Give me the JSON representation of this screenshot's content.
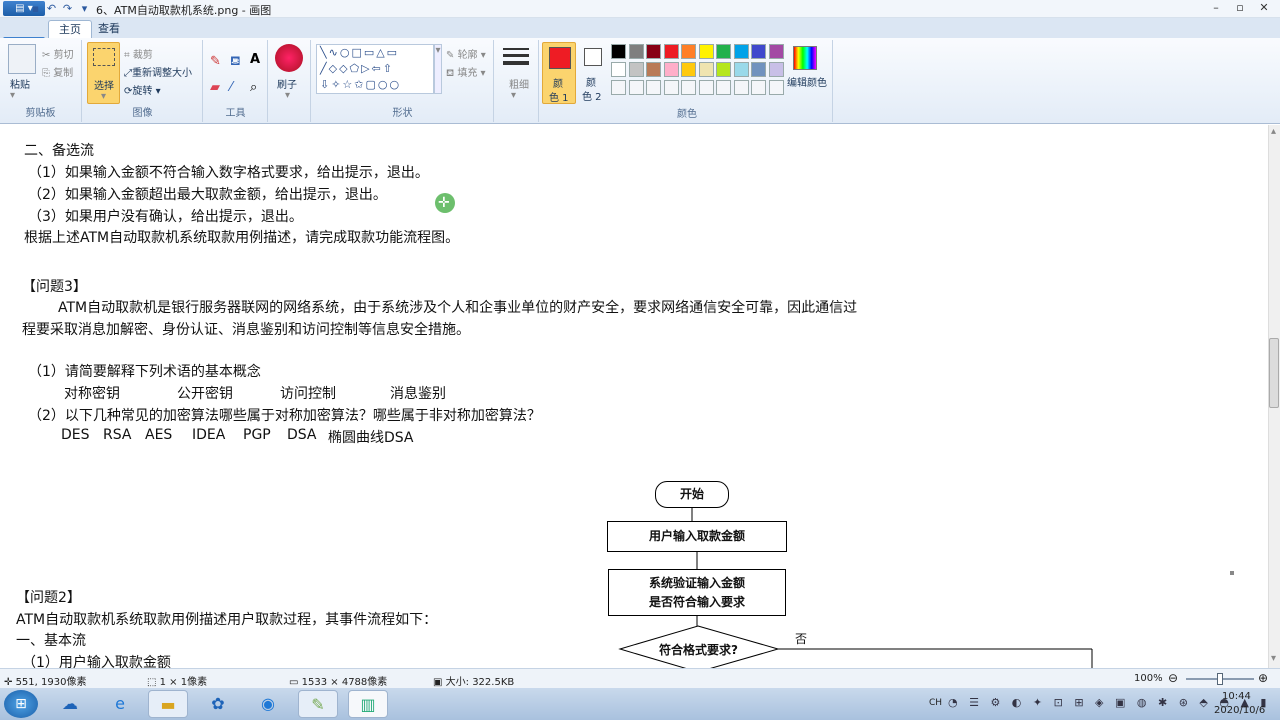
{
  "window": {
    "title": "6、ATM自动取款机系统.png - 画图"
  },
  "quick_access": {
    "menu_label": "▤ ▾"
  },
  "tabs": [
    {
      "label": "主页"
    },
    {
      "label": "查看"
    }
  ],
  "ribbon": {
    "clipboard": {
      "paste": "粘贴",
      "cut": "剪切",
      "copy": "复制",
      "group": "剪贴板"
    },
    "image": {
      "select": "选择",
      "crop": "裁剪",
      "resize": "重新调整大小",
      "rotate": "旋转",
      "group": "图像"
    },
    "tools": {
      "group": "工具"
    },
    "brush": {
      "label": "刷子"
    },
    "shapes": {
      "outline": "轮廓",
      "fill": "填充",
      "group": "形状"
    },
    "size": {
      "label": "粗细"
    },
    "color1": {
      "label1": "颜",
      "label2": "色 1"
    },
    "color2": {
      "label1": "颜",
      "label2": "色 2"
    },
    "edit_colors": "编辑颜色",
    "colors_group": "颜色",
    "color1_value": "#ee1c24",
    "palette_row1": [
      "#000000",
      "#7f7f7f",
      "#880015",
      "#ed1c24",
      "#ff7f27",
      "#fff200",
      "#22b14c",
      "#00a2e8",
      "#3f48cc",
      "#a349a4"
    ],
    "palette_row2": [
      "#ffffff",
      "#c3c3c3",
      "#b97a57",
      "#ffaec9",
      "#ffc90e",
      "#efe4b0",
      "#b5e61d",
      "#99d9ea",
      "#7092be",
      "#c8bfe7"
    ]
  },
  "document": {
    "lines": [
      "二、备选流",
      "（1）如果输入金额不符合输入数字格式要求，给出提示，退出。",
      "（2）如果输入金额超出最大取款金额，给出提示，退出。",
      "（3）如果用户没有确认，给出提示，退出。",
      "根据上述ATM自动取款机系统取款用例描述，请完成取款功能流程图。",
      "【问题3】",
      "ATM自动取款机是银行服务器联网的网络系统，由于系统涉及个人和企事业单位的财产安全，要求网络通信安全可靠，因此通信过",
      "程要采取消息加解密、身份认证、消息鉴别和访问控制等信息安全措施。",
      "（1）请简要解释下列术语的基本概念",
      "对称密钥",
      "公开密钥",
      "访问控制",
      "消息鉴别",
      "（2）以下几种常见的加密算法哪些属于对称加密算法？哪些属于非对称加密算法？",
      "DES",
      "RSA",
      "AES",
      "IDEA",
      "PGP",
      "DSA",
      "椭圆曲线DSA",
      "【问题2】",
      "ATM自动取款机系统取款用例描述用户取款过程，其事件流程如下：",
      "一、基本流",
      "（1）用户输入取款金额"
    ],
    "flowchart": {
      "start": "开始",
      "step1": "用户输入取款金额",
      "step2a": "系统验证输入金额",
      "step2b": "是否符合输入要求",
      "decision": "符合格式要求?",
      "no": "否"
    }
  },
  "status": {
    "cursor": "551, 1930像素",
    "selection": "1 × 1像素",
    "image_size": "1533 × 4788像素",
    "file_size": "大小: 322.5KB",
    "zoom": "100%"
  },
  "tray": {
    "time": "10:44",
    "date": "2020/10/6",
    "lang": "CH"
  }
}
